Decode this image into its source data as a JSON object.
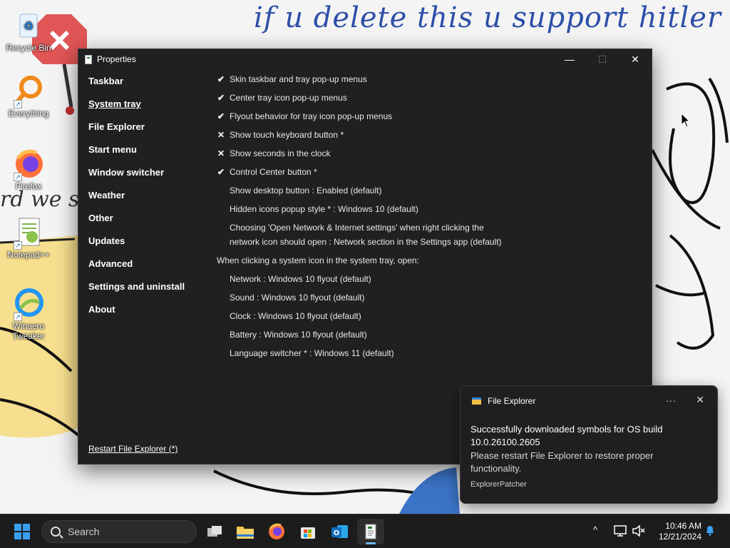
{
  "wallpaper": {
    "top_text": "if u delete this u support hitler",
    "mid_text": "rd we sh"
  },
  "desktop_icons": [
    {
      "label": "Recycle Bin",
      "icon": "recycle-bin-icon"
    },
    {
      "label": "Everything",
      "icon": "everything-search-icon"
    },
    {
      "label": "Firefox",
      "icon": "firefox-icon"
    },
    {
      "label": "Notepad++",
      "icon": "notepad-plus-plus-icon"
    },
    {
      "label": "Winaero Tweaker",
      "icon": "winaero-tweaker-icon"
    }
  ],
  "window": {
    "title": "Properties",
    "minimize_glyph": "—",
    "maximize_glyph": "☐",
    "close_glyph": "✕",
    "nav": [
      {
        "label": "Taskbar"
      },
      {
        "label": "System tray",
        "active": true
      },
      {
        "label": "File Explorer"
      },
      {
        "label": "Start menu"
      },
      {
        "label": "Window switcher"
      },
      {
        "label": "Weather"
      },
      {
        "label": "Other"
      },
      {
        "label": "Updates"
      },
      {
        "label": "Advanced"
      },
      {
        "label": "Settings and uninstall"
      },
      {
        "label": "About"
      }
    ],
    "restart_link": "Restart File Explorer (*)",
    "settings": [
      {
        "mark": "✔",
        "text": "Skin taskbar and tray pop-up menus"
      },
      {
        "mark": "✔",
        "text": "Center tray icon pop-up menus"
      },
      {
        "mark": "✔",
        "text": "Flyout behavior for tray icon pop-up menus"
      },
      {
        "mark": "✕",
        "text": "Show touch keyboard button *"
      },
      {
        "mark": "✕",
        "text": "Show seconds in the clock"
      },
      {
        "mark": "✔",
        "text": "Control Center button *"
      },
      {
        "mark": "",
        "text": "Show desktop button : Enabled (default)"
      },
      {
        "mark": "",
        "text": "Hidden icons popup style * : Windows 10 (default)"
      },
      {
        "mark": "",
        "text": "Choosing 'Open Network & Internet settings' when right clicking the",
        "text2": "network icon should open : Network section in the Settings app (default)"
      }
    ],
    "section_heading": "When clicking a system icon in the system tray, open:",
    "open_options": [
      {
        "text": "Network : Windows 10 flyout (default)"
      },
      {
        "text": "Sound : Windows 10 flyout (default)"
      },
      {
        "text": "Clock : Windows 10 flyout (default)"
      },
      {
        "text": "Battery : Windows 10 flyout (default)"
      },
      {
        "text": "Language switcher * : Windows 11 (default)"
      }
    ]
  },
  "toast": {
    "app_name": "File Explorer",
    "more_glyph": "···",
    "close_glyph": "✕",
    "title": "Successfully downloaded symbols for OS build 10.0.26100.2605",
    "body": "Please restart File Explorer to restore proper functionality.",
    "attribution": "ExplorerPatcher"
  },
  "taskbar": {
    "search_placeholder": "Search",
    "apps": [
      "task-view-icon",
      "file-explorer-icon",
      "firefox-icon",
      "microsoft-store-icon",
      "outlook-new-icon",
      "explorerpatcher-properties-icon"
    ],
    "tray_chevron": "^",
    "time": "10:46 AM",
    "date": "12/21/2024"
  },
  "colors": {
    "window_bg": "#202020",
    "toast_bg": "#1f1f1f",
    "taskbar_bg": "#1c1c1c",
    "accent": "#3aa0f3",
    "wallpaper_text": "#2d4fa8"
  }
}
